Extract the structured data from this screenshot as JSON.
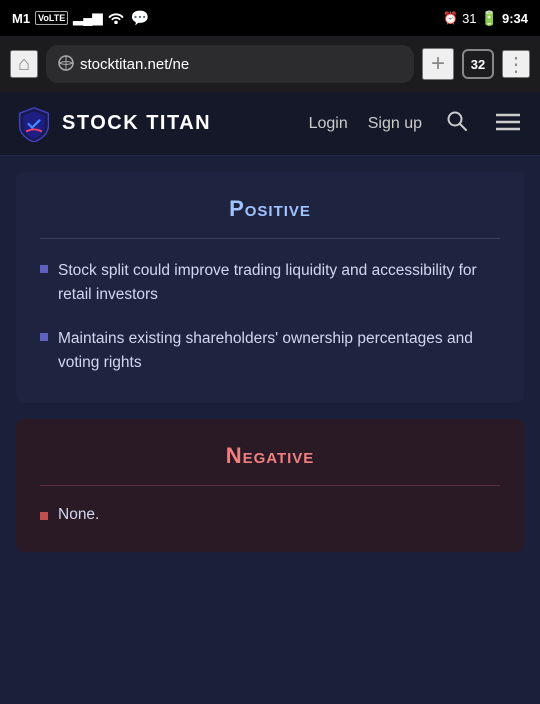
{
  "status_bar": {
    "carrier": "M1",
    "carrier_type": "VoLTE",
    "signal_bars": "▂▄▆",
    "wifi": "WiFi",
    "battery_percent": "31",
    "time": "9:34"
  },
  "browser": {
    "url": "stocktitan.net/ne",
    "tabs_count": "32",
    "home_icon": "⌂",
    "add_icon": "+",
    "more_icon": "⋮"
  },
  "nav": {
    "logo_text": "STOCK TITAN",
    "login_label": "Login",
    "signup_label": "Sign up",
    "search_icon": "🔍",
    "menu_icon": "≡"
  },
  "positive_section": {
    "title": "Positive",
    "bullet_1": "Stock split could improve trading liquidity and accessibility for retail investors",
    "bullet_2": "Maintains existing shareholders' ownership percentages and voting rights"
  },
  "negative_section": {
    "title": "Negative",
    "none_text": "None."
  }
}
